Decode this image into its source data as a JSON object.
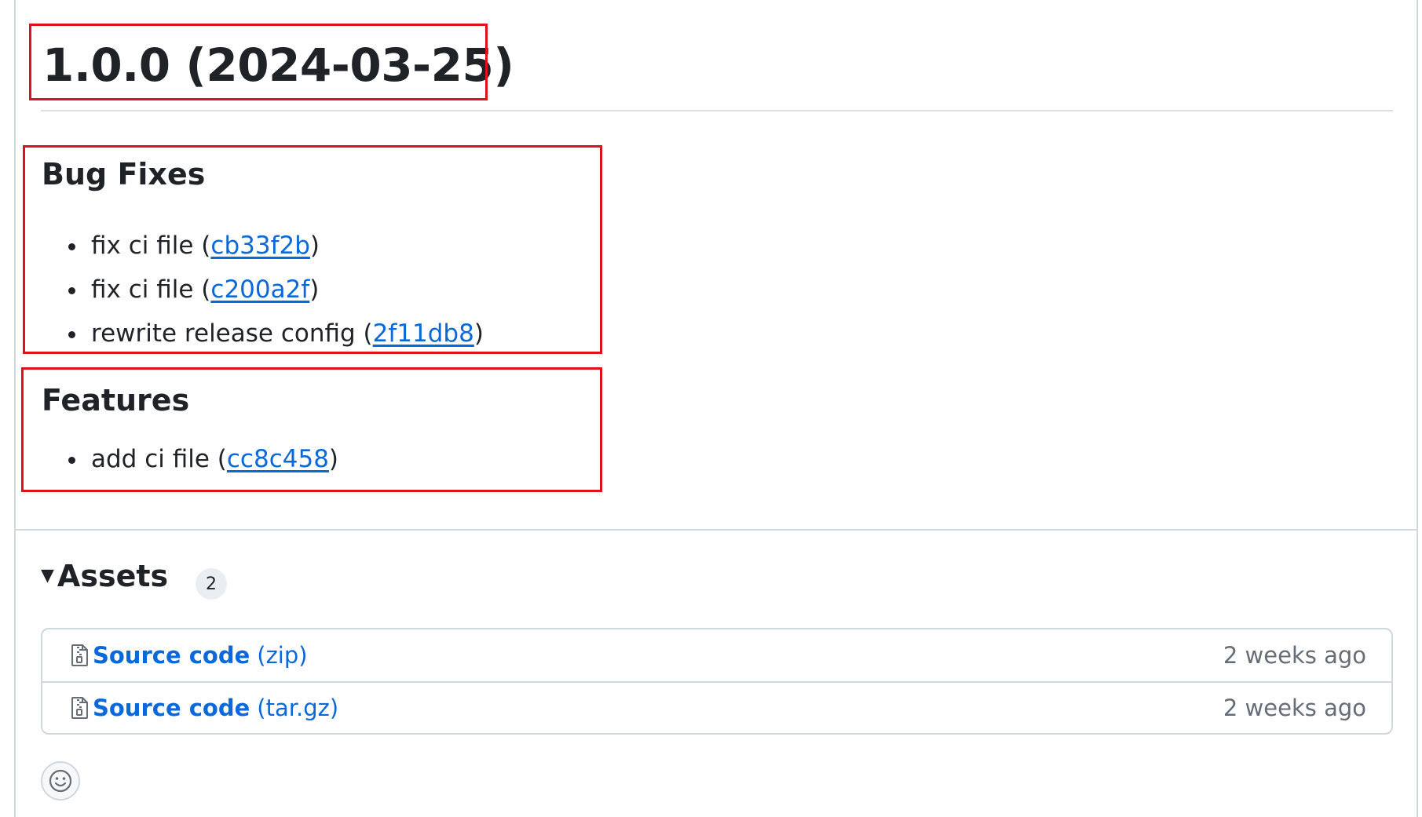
{
  "release": {
    "title": "1.0.0 (2024-03-25)"
  },
  "sections": [
    {
      "heading": "Bug Fixes",
      "items": [
        {
          "text": "fix ci file",
          "sha": "cb33f2b"
        },
        {
          "text": "fix ci file",
          "sha": "c200a2f"
        },
        {
          "text": "rewrite release config",
          "sha": "2f11db8"
        }
      ]
    },
    {
      "heading": "Features",
      "items": [
        {
          "text": "add ci file",
          "sha": "cc8c458"
        }
      ]
    }
  ],
  "assets": {
    "label": "Assets",
    "count": "2",
    "caret_icon": "triangle-down-icon",
    "rows": [
      {
        "name": "Source code",
        "ext": "(zip)",
        "date": "2 weeks ago",
        "icon": "file-zip-icon"
      },
      {
        "name": "Source code",
        "ext": "(tar.gz)",
        "date": "2 weeks ago",
        "icon": "file-zip-icon"
      }
    ]
  },
  "reactions": {
    "icon": "smiley-icon"
  },
  "colors": {
    "link": "#0969da",
    "text": "#1f2328",
    "muted": "#656d76",
    "border": "#d0d7de",
    "highlight": "#e0101b"
  }
}
